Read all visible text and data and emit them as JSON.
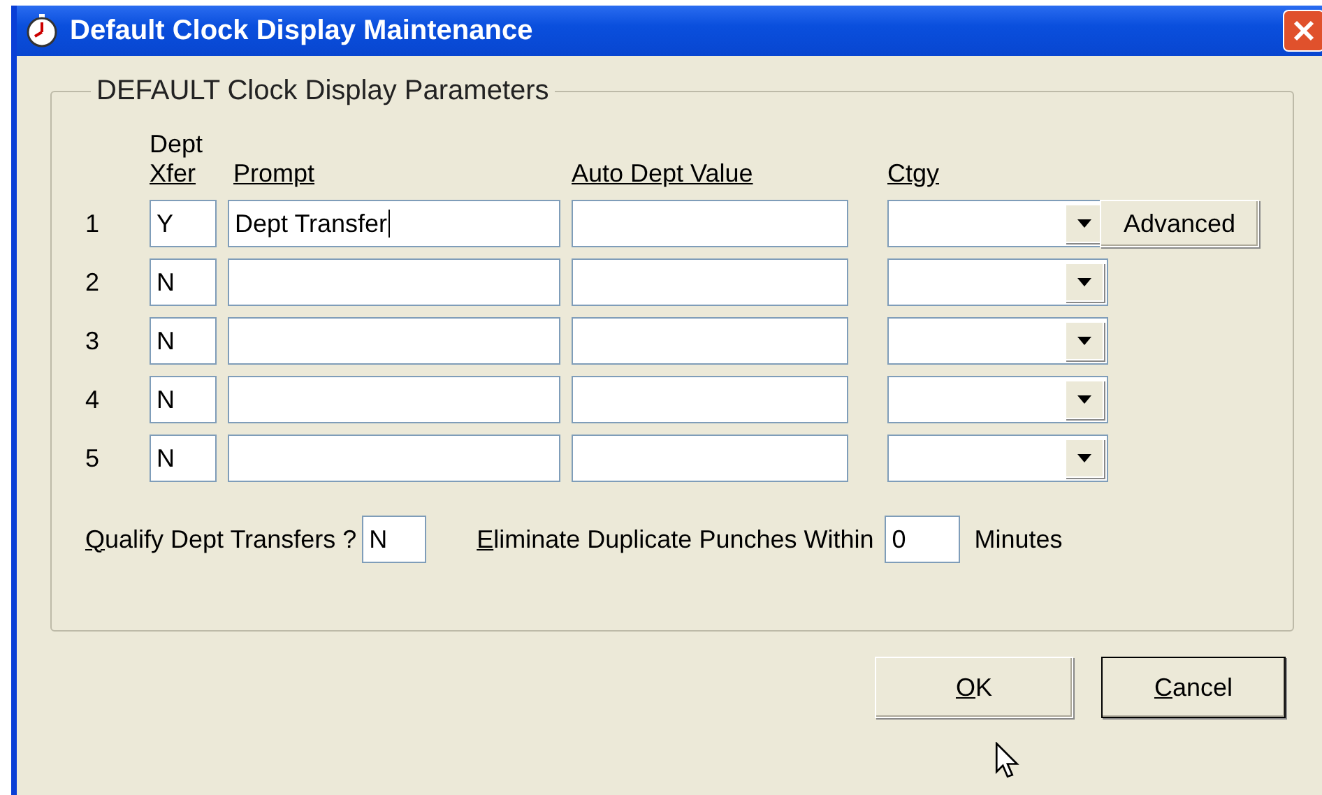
{
  "window": {
    "title": "Default Clock Display Maintenance"
  },
  "group": {
    "title": "DEFAULT Clock Display Parameters"
  },
  "columns": [
    {
      "top": "Dept",
      "label": "Xfer"
    },
    {
      "label": "Prompt"
    },
    {
      "label": "Auto Dept Value"
    },
    {
      "label": "Ctgy"
    }
  ],
  "rows": [
    {
      "number": "1",
      "xfer": "Y",
      "prompt": "Dept Transfer",
      "focused": true,
      "auto_value": "",
      "button": "Advanced"
    },
    {
      "number": "2",
      "xfer": "N",
      "prompt": "",
      "focused": false,
      "auto_value": ""
    },
    {
      "number": "3",
      "xfer": "N",
      "prompt": "",
      "focused": false,
      "auto_value": ""
    },
    {
      "number": "4",
      "xfer": "N",
      "prompt": "",
      "focused": false,
      "auto_value": ""
    },
    {
      "number": "5",
      "xfer": "N",
      "prompt": "",
      "focused": false,
      "auto_value": ""
    }
  ],
  "qualify": {
    "label": "Qualify Dept Transfers ?",
    "value": "N"
  },
  "eliminate": {
    "label": "Eliminate Duplicate Punches Within",
    "value": "0",
    "unit": "Minutes"
  },
  "buttons": [
    {
      "label": "OK",
      "default": false
    },
    {
      "label": "Cancel",
      "default": true
    }
  ]
}
